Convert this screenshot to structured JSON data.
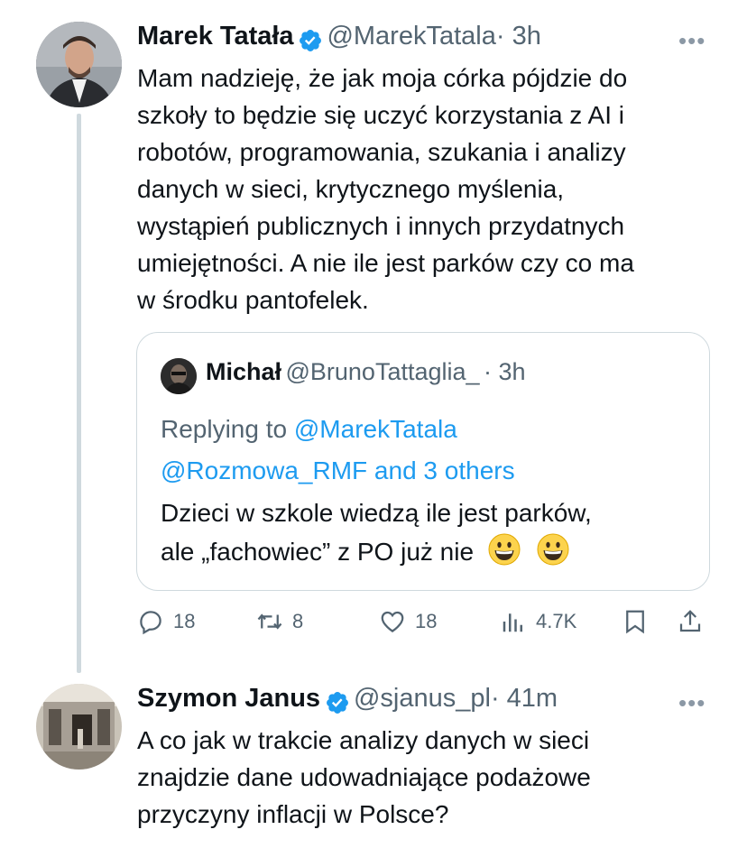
{
  "tweet1": {
    "author_name": "Marek Tatała",
    "handle": "@MarekTatala",
    "time": "· 3h",
    "more": "•••",
    "lines": [
      "Mam nadzieję, że jak moja córka pójdzie do",
      "szkoły to będzie się uczyć korzystania z AI i",
      "robotów, programowania, szukania i analizy",
      "danych w sieci, krytycznego myślenia,",
      "wystąpień publicznych i innych przydatnych",
      "umiejętności. A nie ile jest parków czy co ma",
      "w środku pantofelek."
    ],
    "quote": {
      "author_name": "Michał",
      "handle": "@BrunoTattaglia_",
      "time": "· 3h",
      "replying_prefix": "Replying to ",
      "replying_user1": "@MarekTatala",
      "replying_user2": "@Rozmowa_RMF",
      "replying_suffix": " and 3 others",
      "line1": "Dzieci w szkole wiedzą ile jest parków,",
      "line2": "ale „fachowiec” z PO już nie"
    },
    "actions": {
      "replies": "18",
      "retweets": "8",
      "likes": "18",
      "views": "4.7K"
    }
  },
  "tweet2": {
    "author_name": "Szymon Janus",
    "handle": "@sjanus_pl",
    "time": "· 41m",
    "more": "•••",
    "lines": [
      "A co jak w trakcie analizy danych w sieci",
      "znajdzie dane udowadniające podażowe",
      "przyczyny inflacji w Polsce?"
    ]
  },
  "colors": {
    "accent": "#1d9bf0",
    "muted": "#536471",
    "border": "#cfd9de"
  }
}
